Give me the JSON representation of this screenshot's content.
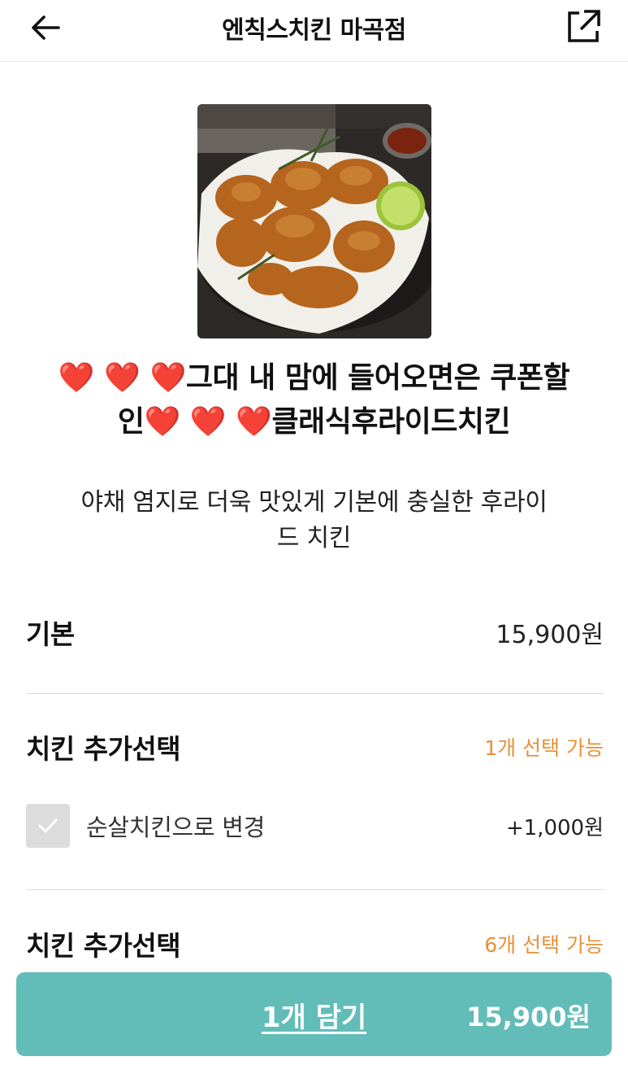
{
  "header": {
    "title": "엔칙스치킨 마곡점"
  },
  "menu": {
    "title_line1": "❤️ ❤️ ❤️그대 내 맘에 들어오면은 쿠폰할",
    "title_line2": "인❤️ ❤️ ❤️클래식후라이드치킨",
    "description_line1": "야채 염지로 더욱 맛있게 기본에 충실한 후라이",
    "description_line2": "드 치킨"
  },
  "base": {
    "label": "기본",
    "price": "15,900원"
  },
  "option_group_1": {
    "label": "치킨 추가선택",
    "hint": "1개 선택 가능",
    "options": [
      {
        "label": "순살치킨으로 변경",
        "price": "+1,000원",
        "checked": false
      }
    ]
  },
  "option_group_2": {
    "label": "치킨 추가선택",
    "hint": "6개 선택 가능"
  },
  "cart": {
    "label": "1개 담기",
    "price": "15,900원"
  },
  "colors": {
    "accent": "#62bdb9",
    "hint": "#e8903a"
  },
  "icons": [
    "arrow-left-icon",
    "share-external-icon",
    "check-icon"
  ]
}
